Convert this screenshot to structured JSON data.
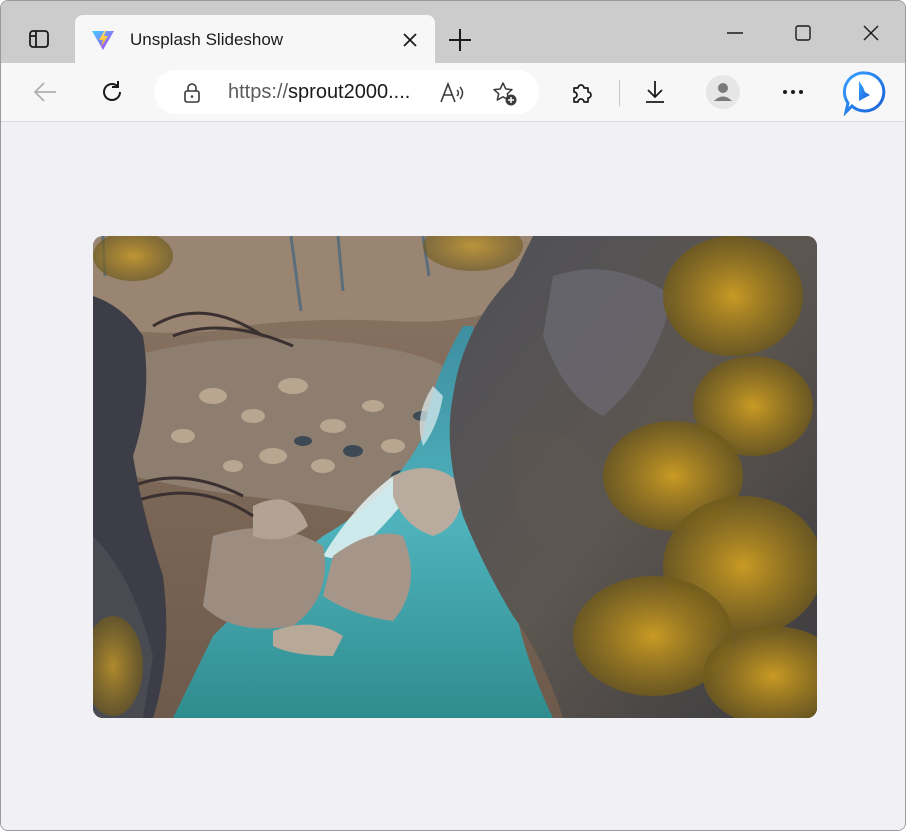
{
  "window": {
    "tab": {
      "title": "Unsplash Slideshow",
      "favicon": "vite-logo-icon"
    }
  },
  "toolbar": {
    "url_scheme": "https://",
    "url_host": "sprout2000....",
    "icons": [
      "back-arrow-icon",
      "refresh-icon",
      "lock-icon",
      "read-aloud-icon",
      "add-favorite-icon",
      "extensions-icon",
      "download-icon",
      "profile-icon",
      "more-icon",
      "bing-chat-icon"
    ]
  },
  "slideshow": {
    "image_subject": "mountain river through rocky canyon with autumn foliage"
  },
  "colors": {
    "tabstrip": "#cccccc",
    "toolbar": "#f7f7f7",
    "page_background": "#f1f0f4",
    "bing_blue": "#1a73e8"
  }
}
